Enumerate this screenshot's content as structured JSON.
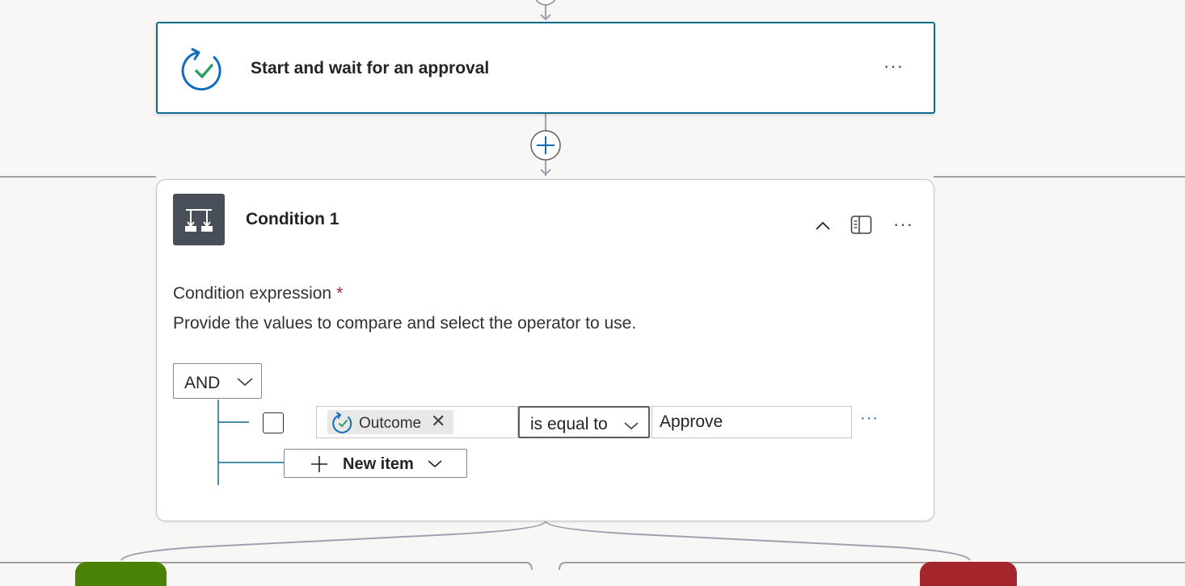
{
  "approval_action": {
    "title": "Start and wait for an approval",
    "more_label": "···"
  },
  "condition_action": {
    "title": "Condition 1",
    "more_label": "···",
    "expression_label": "Condition expression",
    "required_mark": "*",
    "help_text": "Provide the values to compare and select the operator to use.",
    "group_operator": "AND",
    "rows": [
      {
        "left_token": "Outcome",
        "operator": "is equal to",
        "right_value": "Approve",
        "more_label": "···"
      }
    ],
    "new_item_label": "New item"
  },
  "icons": {
    "approval": "approval-refresh-check-icon",
    "condition": "condition-branch-icon",
    "collapse": "chevron-up-icon",
    "panel": "side-panel-icon",
    "add_step": "plus-circle-icon"
  },
  "colors": {
    "accent": "#0f6c8a",
    "yes_branch": "#498205",
    "no_branch": "#a4262c",
    "link": "#0f6cbd",
    "connector": "#a19fb0"
  }
}
